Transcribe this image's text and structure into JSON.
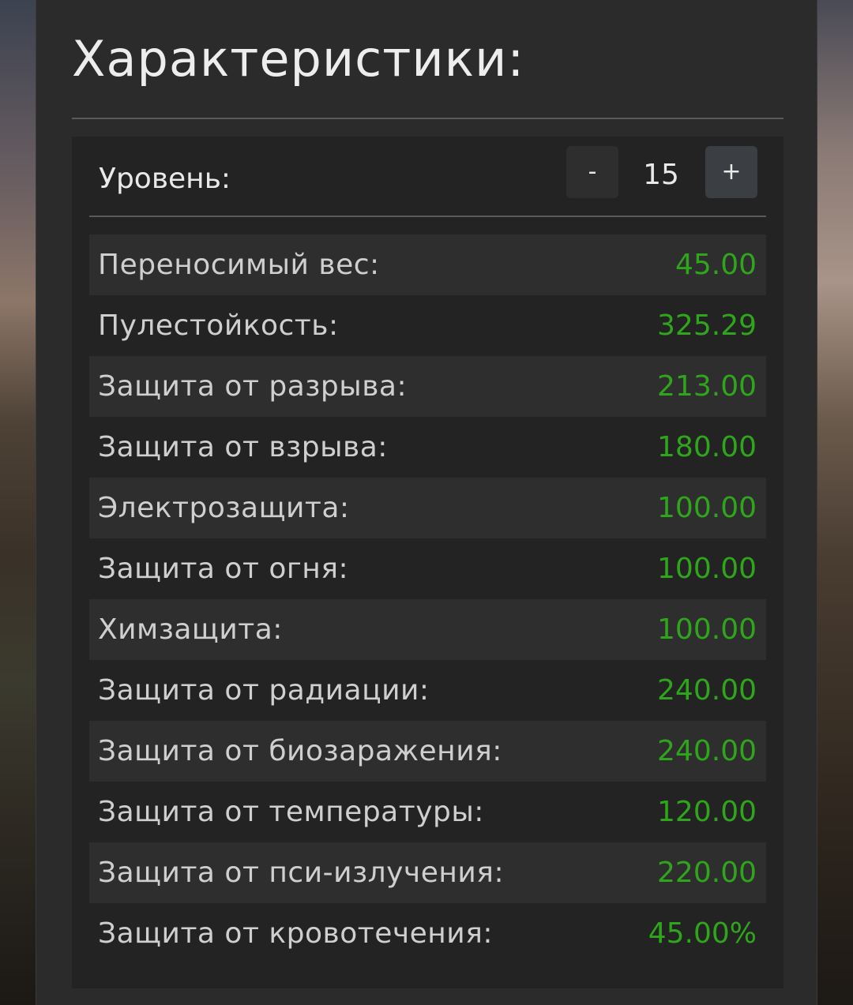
{
  "panel": {
    "title": "Характеристики:"
  },
  "level": {
    "label": "Уровень:",
    "value": "15",
    "decrement_label": "-",
    "increment_label": "+"
  },
  "colors": {
    "value_green": "#2fa51c",
    "panel_bg": "#2b2b2b",
    "box_bg": "#232323",
    "row_alt_bg": "#2e2e2e"
  },
  "stats": [
    {
      "label": "Переносимый вес:",
      "value": "45.00"
    },
    {
      "label": "Пулестойкость:",
      "value": "325.29"
    },
    {
      "label": "Защита от разрыва:",
      "value": "213.00"
    },
    {
      "label": "Защита от взрыва:",
      "value": "180.00"
    },
    {
      "label": "Электрозащита:",
      "value": "100.00"
    },
    {
      "label": "Защита от огня:",
      "value": "100.00"
    },
    {
      "label": "Химзащита:",
      "value": "100.00"
    },
    {
      "label": "Защита от радиации:",
      "value": "240.00"
    },
    {
      "label": "Защита от биозаражения:",
      "value": "240.00"
    },
    {
      "label": "Защита от температуры:",
      "value": "120.00"
    },
    {
      "label": "Защита от пси-излучения:",
      "value": "220.00"
    },
    {
      "label": "Защита от кровотечения:",
      "value": "45.00%"
    }
  ]
}
